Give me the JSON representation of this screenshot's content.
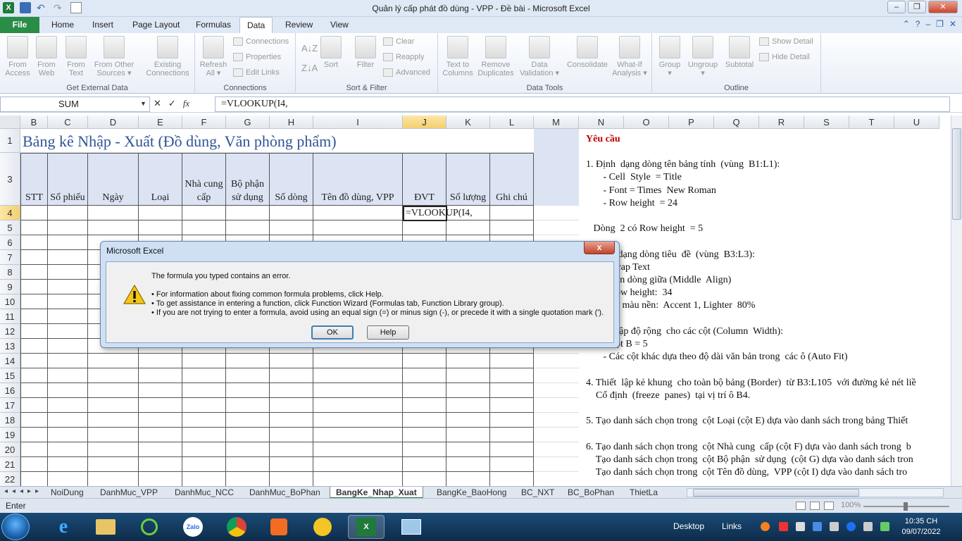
{
  "window": {
    "title": "Quản lý cấp phát đồ dùng - VPP - Đề bài  -  Microsoft Excel",
    "app_icon": "X"
  },
  "ribbon_tabs": [
    "File",
    "Home",
    "Insert",
    "Page Layout",
    "Formulas",
    "Data",
    "Review",
    "View"
  ],
  "active_tab": "Data",
  "ribbon": {
    "get_external": {
      "label": "Get External Data",
      "from_access": "From\nAccess",
      "from_web": "From\nWeb",
      "from_text": "From\nText",
      "from_other": "From Other\nSources ▾",
      "existing": "Existing\nConnections"
    },
    "connections": {
      "label": "Connections",
      "refresh_all": "Refresh\nAll ▾",
      "connections_btn": "Connections",
      "properties": "Properties",
      "edit_links": "Edit Links"
    },
    "sort_filter": {
      "label": "Sort & Filter",
      "sort": "Sort",
      "filter": "Filter",
      "clear": "Clear",
      "reapply": "Reapply",
      "advanced": "Advanced"
    },
    "data_tools": {
      "label": "Data Tools",
      "text_to_columns": "Text to\nColumns",
      "remove_duplicates": "Remove\nDuplicates",
      "data_validation": "Data\nValidation ▾",
      "consolidate": "Consolidate",
      "what_if": "What-If\nAnalysis ▾"
    },
    "outline": {
      "label": "Outline",
      "group": "Group\n▾",
      "ungroup": "Ungroup\n▾",
      "subtotal": "Subtotal",
      "show_detail": "Show Detail",
      "hide_detail": "Hide Detail"
    }
  },
  "formula_bar": {
    "name_box": "SUM",
    "cancel": "✕",
    "enter": "✓",
    "fx": "fx",
    "formula": "=VLOOKUP(I4,"
  },
  "columns": [
    "B",
    "C",
    "D",
    "E",
    "F",
    "G",
    "H",
    "I",
    "J",
    "K",
    "L",
    "M",
    "N",
    "O",
    "P",
    "Q",
    "R",
    "S",
    "T",
    "U"
  ],
  "rows": [
    "1",
    "3",
    "4",
    "5",
    "6",
    "7",
    "8",
    "9",
    "10",
    "11",
    "12",
    "13",
    "14",
    "15",
    "16",
    "17",
    "18",
    "19",
    "20",
    "21",
    "22"
  ],
  "sheet": {
    "title": "Bảng kê Nhập - Xuất (Đồ dùng, Văn phòng phẩm)",
    "headers": [
      "STT",
      "Số phiếu",
      "Ngày",
      "Loại",
      "Nhà cung\ncấp",
      "Bộ phận\nsử dụng",
      "Số dòng",
      "Tên đồ dùng, VPP",
      "ĐVT",
      "Số lượng",
      "Ghi chú"
    ],
    "active_cell_value": "=VLOOKUP(I4,"
  },
  "requirements": {
    "title": "Yêu cầu",
    "lines": [
      "1. Định  dạng dòng tên bảng tính  (vùng  B1:L1):",
      "       - Cell  Style  = Title",
      "       - Font = Times  New Roman",
      "       - Row height  = 24",
      "",
      "   Dòng  2 có Row height  = 5",
      "",
      "   Định  dạng dòng tiêu  đề  (vùng  B3:L3):",
      "       - Wrap Text",
      "       - Căn dòng giữa (Middle  Align)",
      "       - Row height:  34",
      "       - Tô màu nền:  Accent 1, Lighter  80%",
      "",
      "   Thiết lập độ rộng  cho các cột (Column  Width):",
      "       - Cột B = 5",
      "       - Các cột khác dựa theo độ dài văn bản trong  các ô (Auto Fit)",
      "",
      "4. Thiết  lập kẻ khung  cho toàn bộ bảng (Border)  từ B3:L105  với đường kẻ nét liề",
      "    Cố định  (freeze  panes)  tại vị trí ô B4.",
      "",
      "5. Tạo danh sách chọn trong  cột Loại (cột E) dựa vào danh sách trong bảng Thiết",
      "",
      "6. Tạo danh sách chọn trong  cột Nhà cung  cấp (cột F) dựa vào danh sách trong  b",
      "    Tạo danh sách chọn trong  cột Bộ phận  sử dụng  (cột G) dựa vào danh sách tron",
      "    Tạo danh sách chọn trong  cột Tên đồ dùng,  VPP (cột I) dựa vào danh sách tro"
    ]
  },
  "sheet_tabs": [
    "NoiDung",
    "DanhMuc_VPP",
    "DanhMuc_NCC",
    "DanhMuc_BoPhan",
    "BangKe_Nhap_Xuat",
    "BangKe_BaoHong",
    "BC_NXT",
    "BC_BoPhan",
    "ThietLa"
  ],
  "active_sheet": "BangKe_Nhap_Xuat",
  "status": {
    "mode": "Enter",
    "zoom": "100%"
  },
  "dialog": {
    "title": "Microsoft Excel",
    "close": "x",
    "message": "The formula you typed contains an error.",
    "bullets": [
      "• For information about fixing common formula problems, click Help.",
      "• To get assistance in entering a function, click Function Wizard (Formulas tab, Function Library group).",
      "• If you are not trying to enter a formula, avoid using an equal sign (=) or minus sign (-), or precede it with a single quotation mark (')."
    ],
    "ok": "OK",
    "help": "Help"
  },
  "taskbar": {
    "desktop": "Desktop",
    "links": "Links",
    "time": "10:35 CH",
    "date": "09/07/2022",
    "zalo": "Zalo"
  },
  "colors": {
    "accent": "#1e7145",
    "header_fill": "#dce4f3",
    "title": "#2f5597",
    "req_title": "#c00000"
  }
}
